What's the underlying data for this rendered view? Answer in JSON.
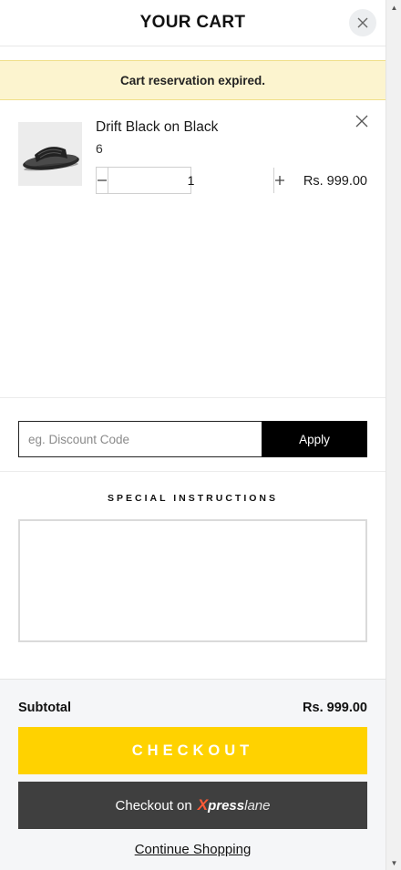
{
  "header": {
    "title": "YOUR CART"
  },
  "notice": {
    "text": "Cart reservation expired."
  },
  "items": [
    {
      "name": "Drift Black on Black",
      "variant": "6",
      "quantity": "1",
      "price": "Rs. 999.00"
    }
  ],
  "discount": {
    "placeholder": "eg. Discount Code",
    "apply_label": "Apply"
  },
  "special_instructions": {
    "label": "SPECIAL INSTRUCTIONS",
    "value": ""
  },
  "footer": {
    "subtotal_label": "Subtotal",
    "subtotal_value": "Rs. 999.00",
    "checkout_label": "CHECKOUT",
    "xpress_prefix": "Checkout on",
    "xpress_x": "X",
    "xpress_press": "press",
    "xpress_lane": "lane",
    "continue_label": "Continue Shopping"
  },
  "colors": {
    "checkout_yellow": "#ffd200",
    "xpress_dark": "#3f3f3f",
    "xpress_brand": "#ff5a36",
    "notice_bg": "#fcf4cf"
  },
  "icons": [
    "close-icon",
    "remove-item-icon",
    "minus-icon",
    "plus-icon",
    "slide-sandal-image",
    "scroll-up-arrow-icon",
    "scroll-down-arrow-icon"
  ]
}
